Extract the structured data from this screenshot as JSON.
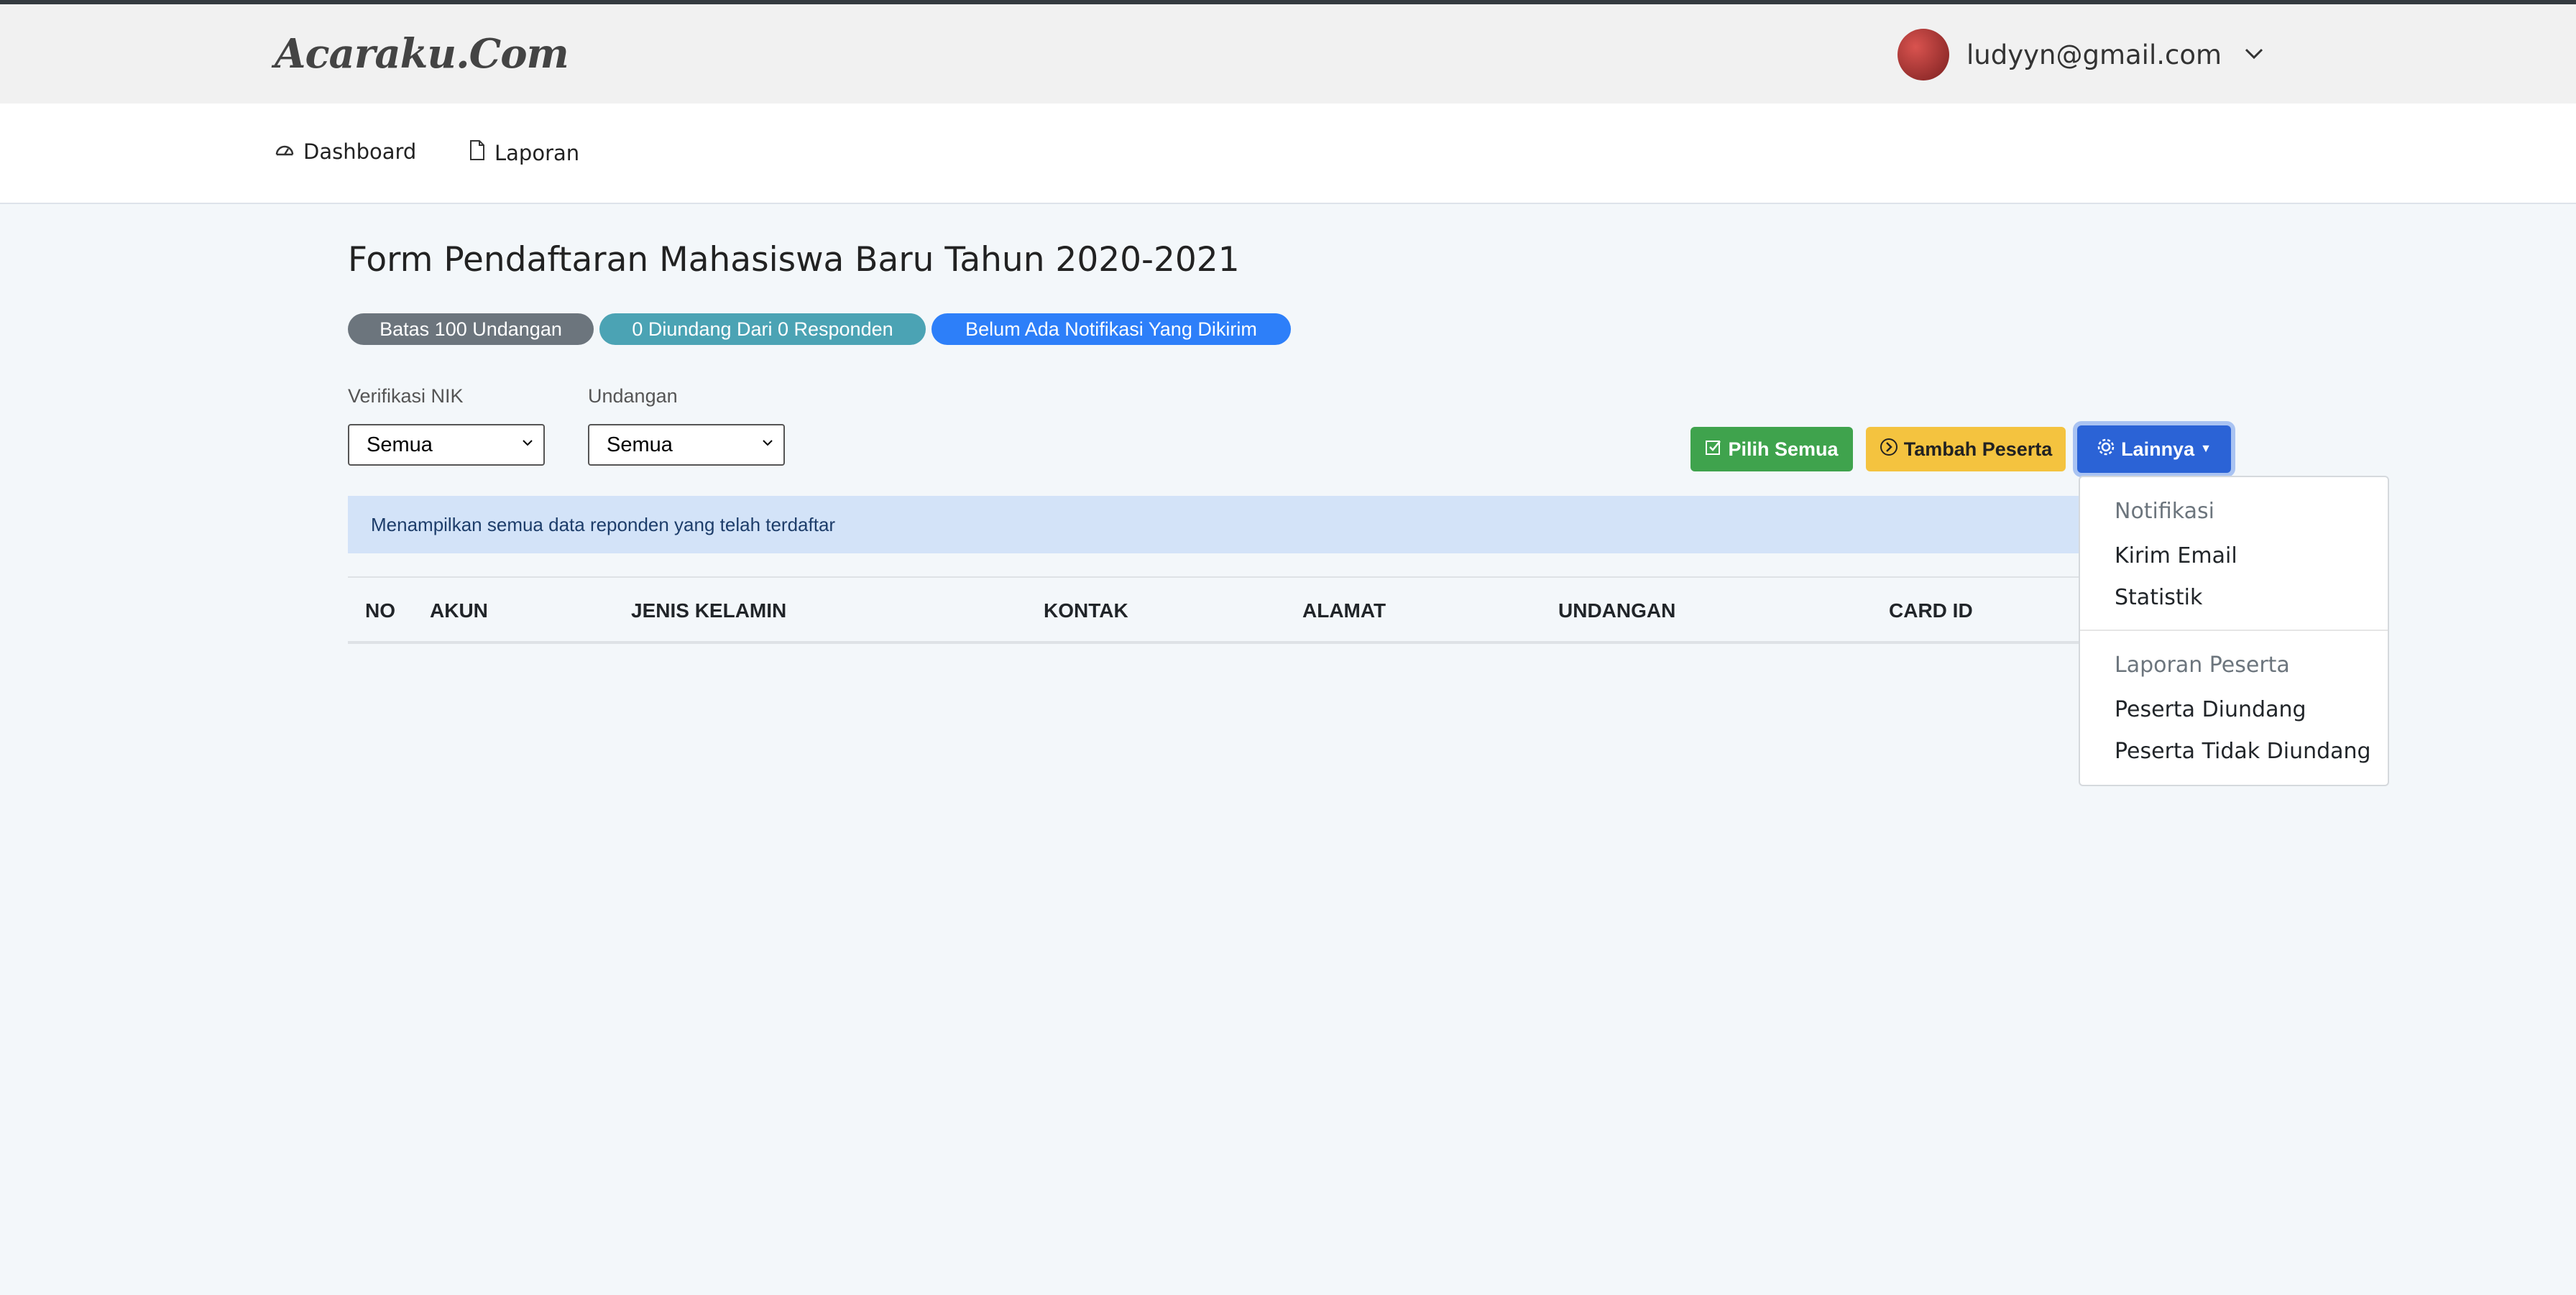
{
  "header": {
    "brand": "Acaraku.Com",
    "user_email": "ludyyn@gmail.com",
    "user_icon": "chevron-down-icon"
  },
  "nav": {
    "dashboard": "Dashboard",
    "laporan": "Laporan"
  },
  "page": {
    "title": "Form Pendaftaran Mahasiswa Baru Tahun 2020-2021"
  },
  "badges": {
    "limit": "Batas 100 Undangan",
    "invited": "0 Diundang Dari 0 Responden",
    "notification": "Belum Ada Notifikasi Yang Dikirim"
  },
  "filters": {
    "nik_label": "Verifikasi NIK",
    "nik_value": "Semua",
    "undangan_label": "Undangan",
    "undangan_value": "Semua"
  },
  "actions": {
    "select_all": "Pilih Semua",
    "add_participant": "Tambah Peserta",
    "more": "Lainnya"
  },
  "alert": {
    "text": "Menampilkan semua data reponden yang telah terdaftar"
  },
  "table": {
    "columns": [
      "NO",
      "AKUN",
      "JENIS KELAMIN",
      "KONTAK",
      "ALAMAT",
      "UNDANGAN",
      "CARD ID"
    ]
  },
  "dropdown": {
    "section1_header": "Notifikasi",
    "kirim_email": "Kirim Email",
    "statistik": "Statistik",
    "section2_header": "Laporan Peserta",
    "peserta_diundang": "Peserta Diundang",
    "peserta_tidak_diundang": "Peserta Tidak Diundang"
  },
  "colors": {
    "green": "#3fa34d",
    "yellow": "#f4c33f",
    "blue": "#2b63d6",
    "badge_gray": "#6c757d",
    "badge_teal": "#4ba3b4",
    "badge_blue": "#2d7ff9"
  }
}
